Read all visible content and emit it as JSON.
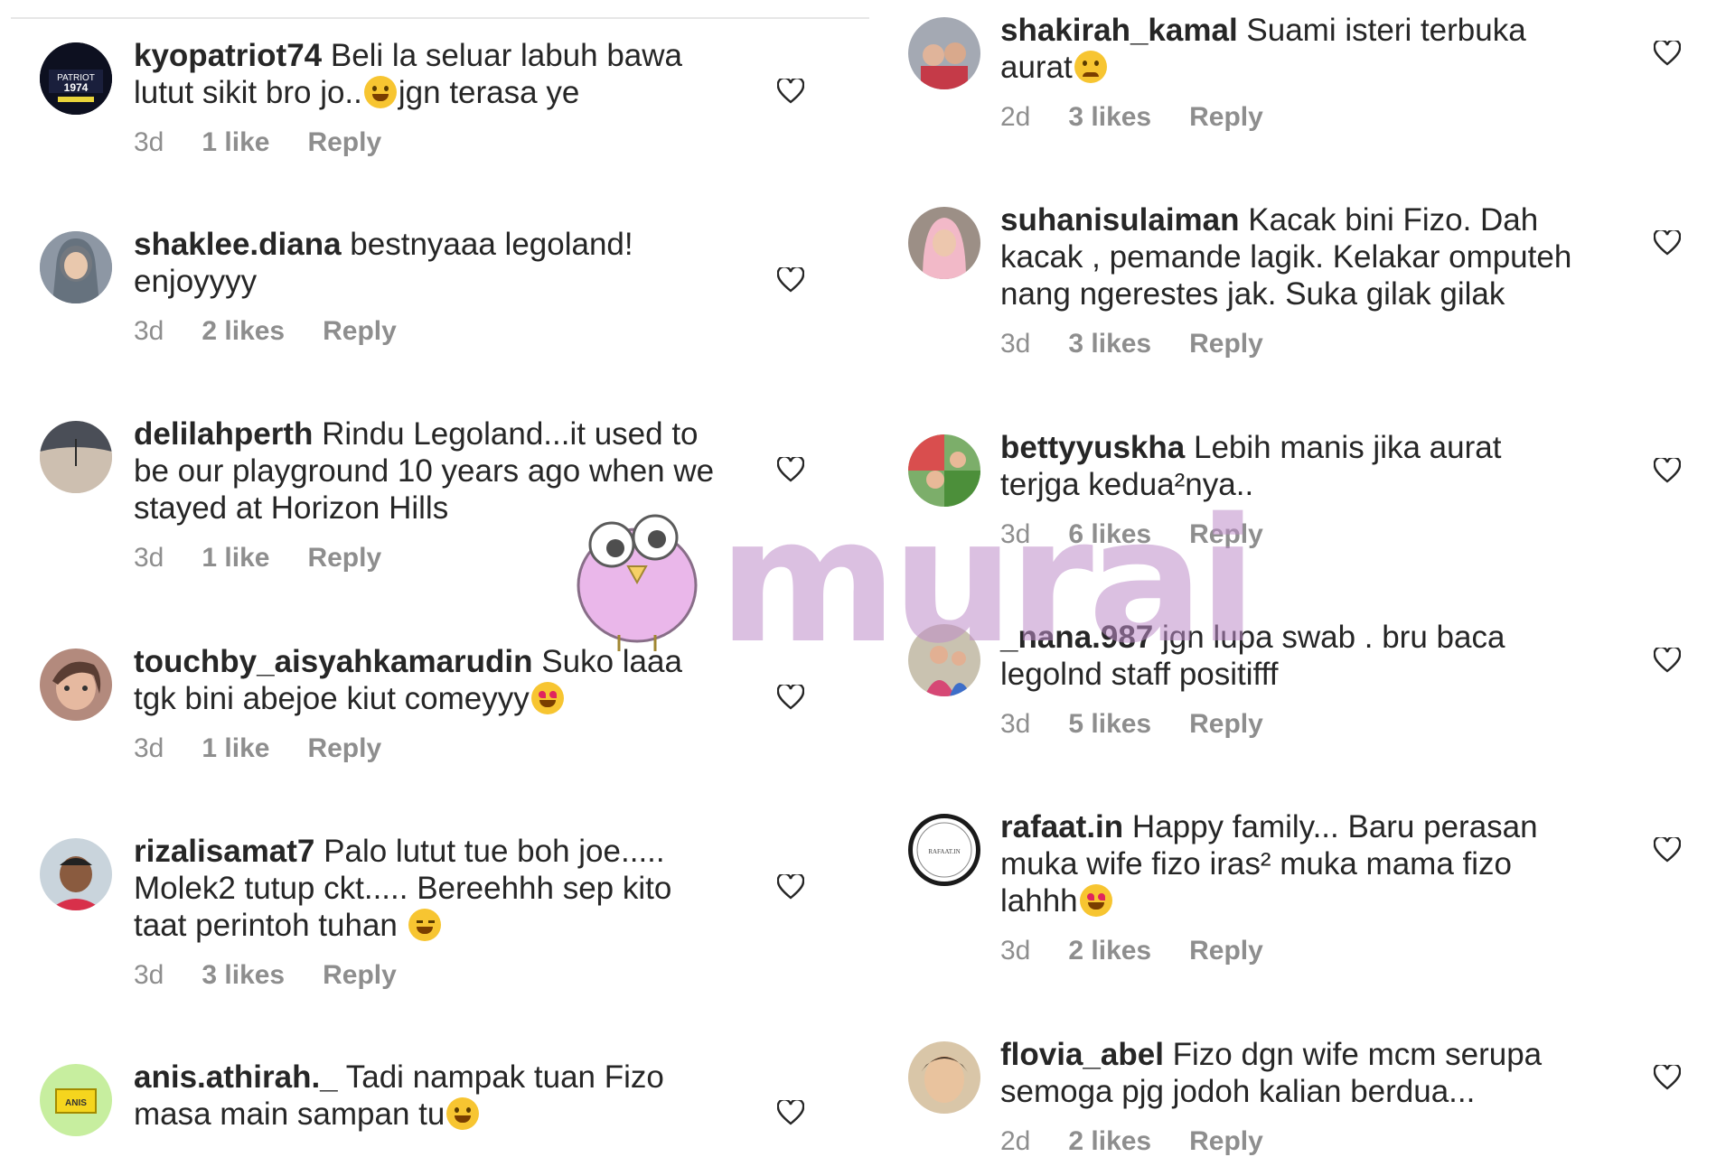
{
  "watermark": {
    "text": "murai"
  },
  "left_comments": [
    {
      "username": "kyopatriot74",
      "text_1": " Beli la seluar labuh bawa",
      "text_2": "lutut sikit bro jo..",
      "text_3": "jgn terasa ye",
      "time": "3d",
      "likes": "1 like",
      "reply": "Reply"
    },
    {
      "username": "shaklee.diana",
      "text_1": " bestnyaaa legoland!",
      "text_2": "enjoyyyy",
      "time": "3d",
      "likes": "2 likes",
      "reply": "Reply"
    },
    {
      "username": "delilahperth",
      "text_1": " Rindu Legoland...it used to",
      "text_2": "be our playground 10 years ago when we",
      "text_3": "stayed at Horizon Hills",
      "time": "3d",
      "likes": "1 like",
      "reply": "Reply"
    },
    {
      "username": "touchby_aisyahkamarudin",
      "text_1": " Suko laaa",
      "text_2": "tgk bini abejoe kiut comeyyy",
      "time": "3d",
      "likes": "1 like",
      "reply": "Reply"
    },
    {
      "username": "rizalisamat7",
      "text_1": " Palo lutut tue boh joe.....",
      "text_2": "Molek2 tutup ckt..... Bereehhh sep kito",
      "text_3": "taat perintoh tuhan ",
      "time": "3d",
      "likes": "3 likes",
      "reply": "Reply"
    },
    {
      "username": "anis.athirah._",
      "text_1": " Tadi nampak tuan Fizo",
      "text_2": "masa main sampan tu",
      "time": "",
      "likes": "",
      "reply": ""
    }
  ],
  "right_comments": [
    {
      "username": "shakirah_kamal",
      "text_1": " Suami isteri terbuka",
      "text_2": "aurat",
      "time": "2d",
      "likes": "3 likes",
      "reply": "Reply"
    },
    {
      "username": "suhanisulaiman",
      "text_1": " Kacak bini Fizo. Dah",
      "text_2": "kacak , pemande lagik. Kelakar omputeh",
      "text_3": "nang ngerestes jak. Suka gilak gilak",
      "time": "3d",
      "likes": "3 likes",
      "reply": "Reply"
    },
    {
      "username": "bettyyuskha",
      "text_1": " Lebih manis jika aurat",
      "text_2": "terjga kedua²nya..",
      "time": "3d",
      "likes": "6 likes",
      "reply": "Reply"
    },
    {
      "username": "_nana.987",
      "text_1": " jgn lupa swab . bru baca",
      "text_2": "legolnd staff positifff",
      "time": "3d",
      "likes": "5 likes",
      "reply": "Reply"
    },
    {
      "username": "rafaat.in",
      "text_1": " Happy family... Baru perasan",
      "text_2": "muka wife fizo iras² muka mama fizo",
      "text_3": "lahhh",
      "time": "3d",
      "likes": "2 likes",
      "reply": "Reply"
    },
    {
      "username": "flovia_abel",
      "text_1": " Fizo dgn wife mcm serupa",
      "text_2": "semoga pjg jodoh kalian berdua...",
      "time": "2d",
      "likes": "2 likes",
      "reply": "Reply"
    }
  ],
  "avatar_texts": {
    "kyo_1": "PATRIOT",
    "kyo_2": "1974",
    "rafaat": "RAFAAT.IN",
    "anis": "ANIS"
  },
  "colors": {
    "meta": "#8e8e8e",
    "text": "#262626",
    "watermark": "#c9a6d3"
  }
}
